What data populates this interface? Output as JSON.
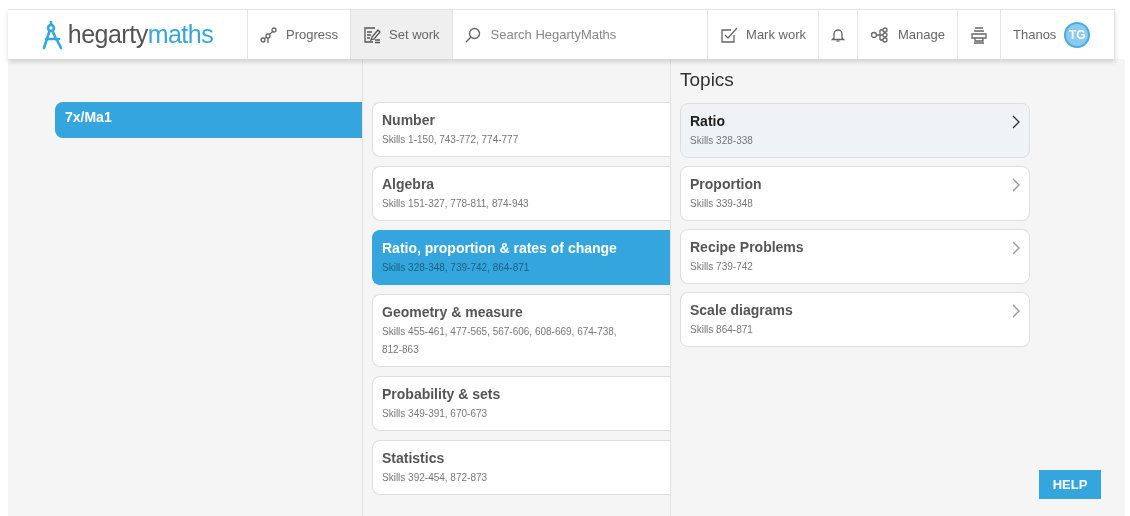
{
  "logo": {
    "part_1": "hegarty",
    "part_2": "maths"
  },
  "nav": [
    {
      "kind": "progress",
      "label": "Progress",
      "selected": false
    },
    {
      "kind": "setwork",
      "label": "Set work",
      "selected": true
    }
  ],
  "search": {
    "placeholder": "Search HegartyMaths"
  },
  "nav_right": [
    {
      "kind": "mark",
      "label": "Mark work"
    },
    {
      "kind": "bell"
    },
    {
      "kind": "manage",
      "label": "Manage"
    },
    {
      "kind": "print"
    }
  ],
  "user": {
    "name": "Thanos",
    "initials": "TG"
  },
  "classes": [
    {
      "label": "7x/Ma1",
      "selected": true
    }
  ],
  "strands": [
    {
      "title": "Number",
      "skills": "Skills 1-150, 743-772, 774-777",
      "selected": false
    },
    {
      "title": "Algebra",
      "skills": "Skills 151-327, 778-811, 874-943",
      "selected": false
    },
    {
      "title": "Ratio, proportion & rates of change",
      "skills": "Skills 328-348, 739-742, 864-871",
      "selected": true
    },
    {
      "title": "Geometry & measure",
      "skills": "Skills 455-461, 477-565, 567-606, 608-669, 674-738, 812-863",
      "selected": false
    },
    {
      "title": "Probability & sets",
      "skills": "Skills 349-391, 670-673",
      "selected": false
    },
    {
      "title": "Statistics",
      "skills": "Skills 392-454, 872-873",
      "selected": false
    }
  ],
  "topics_heading": "Topics",
  "topics": [
    {
      "title": "Ratio",
      "skills": "Skills 328-338",
      "highlighted": true
    },
    {
      "title": "Proportion",
      "skills": "Skills 339-348",
      "highlighted": false
    },
    {
      "title": "Recipe Problems",
      "skills": "Skills 739-742",
      "highlighted": false
    },
    {
      "title": "Scale diagrams",
      "skills": "Skills 864-871",
      "highlighted": false
    }
  ],
  "help_button": "HELP"
}
